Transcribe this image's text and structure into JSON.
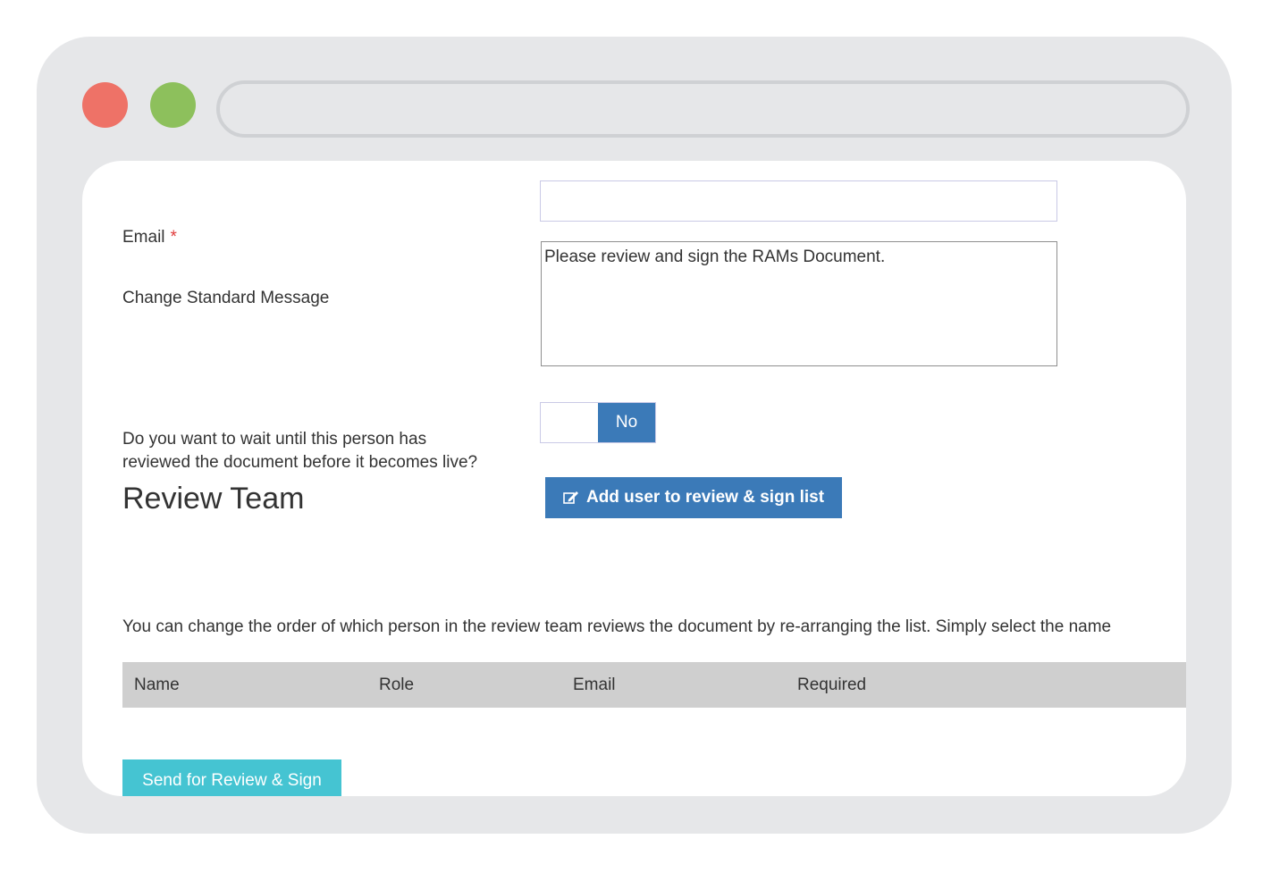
{
  "window": {
    "close_color": "#ee7267",
    "maximize_color": "#8dc05c",
    "address_bar_value": ""
  },
  "form": {
    "email": {
      "label": "Email",
      "required_mark": "*",
      "value": ""
    },
    "message": {
      "label": "Change Standard Message",
      "value": "Please review and sign the RAMs Document."
    },
    "wait": {
      "label_line1": "Do you want to wait until this person has",
      "label_line2": "reviewed the document before it becomes live?",
      "toggle_value": "No"
    }
  },
  "review_team": {
    "title": "Review Team",
    "add_button_icon": "edit-icon",
    "add_button_label": "Add user to review & sign list",
    "instructions": "You can change the order of which person in the review team reviews the document by re-arranging the list. Simply select the name",
    "columns": [
      "Name",
      "Role",
      "Email",
      "Required"
    ]
  },
  "actions": {
    "send_label": "Send for Review & Sign",
    "send_color": "#45c4d2",
    "primary_color": "#3b7ab8"
  }
}
